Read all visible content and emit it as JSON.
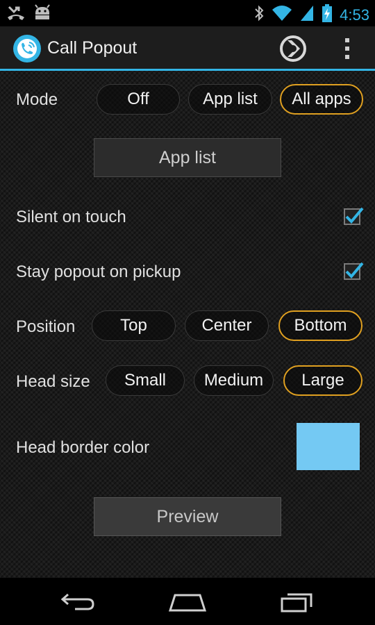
{
  "status_bar": {
    "time": "4:53",
    "icons": [
      "missed-call-icon",
      "android-debug-icon",
      "bluetooth-icon",
      "wifi-icon",
      "signal-icon",
      "battery-charging-icon"
    ]
  },
  "action_bar": {
    "title": "Call Popout",
    "icons": [
      "app-logo-icon",
      "plex-icon",
      "overflow-menu-icon"
    ]
  },
  "mode": {
    "label": "Mode",
    "options": [
      "Off",
      "App list",
      "All apps"
    ],
    "selected": "All apps"
  },
  "app_list_button": "App list",
  "silent_on_touch": {
    "label": "Silent on touch",
    "checked": true
  },
  "stay_popout": {
    "label": "Stay popout on pickup",
    "checked": true
  },
  "position": {
    "label": "Position",
    "options": [
      "Top",
      "Center",
      "Bottom"
    ],
    "selected": "Bottom"
  },
  "head_size": {
    "label": "Head size",
    "options": [
      "Small",
      "Medium",
      "Large"
    ],
    "selected": "Large"
  },
  "head_border_color": {
    "label": "Head border color",
    "color": "#74c9f3"
  },
  "preview_button": "Preview",
  "colors": {
    "accent": "#33b5e5",
    "selected_border": "#e0a020"
  },
  "nav_bar": {
    "icons": [
      "back-icon",
      "home-icon",
      "recent-apps-icon"
    ]
  }
}
